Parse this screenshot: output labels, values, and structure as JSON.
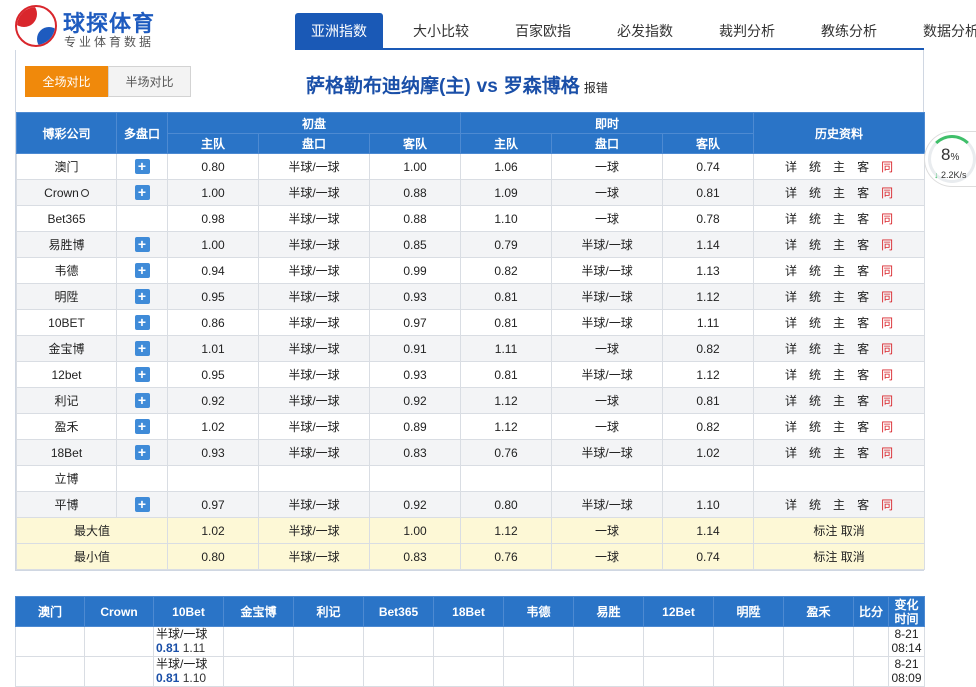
{
  "site": {
    "logo_name": "球探体育",
    "logo_sub": "专业体育数据"
  },
  "nav": [
    "亚洲指数",
    "大小比较",
    "百家欧指",
    "必发指数",
    "裁判分析",
    "教练分析",
    "数据分析"
  ],
  "tabs": [
    "全场对比",
    "半场对比"
  ],
  "match": {
    "home": "萨格勒布迪纳摩(主)",
    "vs": "vs",
    "away": "罗森博格",
    "report": "报错"
  },
  "table": {
    "headers": {
      "company": "博彩公司",
      "multi": "多盘口",
      "initial": "初盘",
      "live": "即时",
      "history": "历史资料",
      "home": "主队",
      "handicap": "盘口",
      "away": "客队"
    },
    "rows": [
      {
        "company": "澳门",
        "plus": true,
        "i_home": "0.80",
        "i_hc": "半球/一球",
        "i_away": "1.00",
        "l_home": "1.06",
        "l_hc": "一球",
        "l_away": "0.74",
        "hist": true
      },
      {
        "company": "Crown",
        "plus": true,
        "i_home": "1.00",
        "i_hc": "半球/一球",
        "i_away": "0.88",
        "l_home": "1.09",
        "l_hc": "一球",
        "l_away": "0.81",
        "hist": true
      },
      {
        "company": "Bet365",
        "plus": false,
        "i_home": "0.98",
        "i_hc": "半球/一球",
        "i_away": "0.88",
        "l_home": "1.10",
        "l_hc": "一球",
        "l_away": "0.78",
        "hist": true
      },
      {
        "company": "易胜博",
        "plus": true,
        "i_home": "1.00",
        "i_hc": "半球/一球",
        "i_away": "0.85",
        "l_home": "0.79",
        "l_hc": "半球/一球",
        "l_away": "1.14",
        "hist": true
      },
      {
        "company": "韦德",
        "plus": true,
        "i_home": "0.94",
        "i_hc": "半球/一球",
        "i_away": "0.99",
        "l_home": "0.82",
        "l_hc": "半球/一球",
        "l_away": "1.13",
        "hist": true
      },
      {
        "company": "明陞",
        "plus": true,
        "i_home": "0.95",
        "i_hc": "半球/一球",
        "i_away": "0.93",
        "l_home": "0.81",
        "l_hc": "半球/一球",
        "l_away": "1.12",
        "hist": true
      },
      {
        "company": "10BET",
        "plus": true,
        "i_home": "0.86",
        "i_hc": "半球/一球",
        "i_away": "0.97",
        "l_home": "0.81",
        "l_hc": "半球/一球",
        "l_away": "1.11",
        "hist": true
      },
      {
        "company": "金宝博",
        "plus": true,
        "i_home": "1.01",
        "i_hc": "半球/一球",
        "i_away": "0.91",
        "l_home": "1.11",
        "l_hc": "一球",
        "l_away": "0.82",
        "hist": true
      },
      {
        "company": "12bet",
        "plus": true,
        "i_home": "0.95",
        "i_hc": "半球/一球",
        "i_away": "0.93",
        "l_home": "0.81",
        "l_hc": "半球/一球",
        "l_away": "1.12",
        "hist": true
      },
      {
        "company": "利记",
        "plus": true,
        "i_home": "0.92",
        "i_hc": "半球/一球",
        "i_away": "0.92",
        "l_home": "1.12",
        "l_hc": "一球",
        "l_away": "0.81",
        "hist": true
      },
      {
        "company": "盈禾",
        "plus": true,
        "i_home": "1.02",
        "i_hc": "半球/一球",
        "i_away": "0.89",
        "l_home": "1.12",
        "l_hc": "一球",
        "l_away": "0.82",
        "hist": true
      },
      {
        "company": "18Bet",
        "plus": true,
        "i_home": "0.93",
        "i_hc": "半球/一球",
        "i_away": "0.83",
        "l_home": "0.76",
        "l_hc": "半球/一球",
        "l_away": "1.02",
        "hist": true
      },
      {
        "company": "立博",
        "plus": false,
        "i_home": "",
        "i_hc": "",
        "i_away": "",
        "l_home": "",
        "l_hc": "",
        "l_away": "",
        "hist": false
      },
      {
        "company": "平博",
        "plus": true,
        "i_home": "0.97",
        "i_hc": "半球/一球",
        "i_away": "0.92",
        "l_home": "0.80",
        "l_hc": "半球/一球",
        "l_away": "1.10",
        "hist": true
      }
    ],
    "plus_symbol": "+",
    "hist_links": [
      "详",
      "统",
      "主",
      "客",
      "同"
    ],
    "summary": [
      {
        "label": "最大值",
        "i_home": "1.02",
        "i_hc": "半球/一球",
        "i_away": "1.00",
        "l_home": "1.12",
        "l_hc": "一球",
        "l_away": "1.14",
        "actions": [
          "标注",
          "取消"
        ]
      },
      {
        "label": "最小值",
        "i_home": "0.80",
        "i_hc": "半球/一球",
        "i_away": "0.83",
        "l_home": "0.76",
        "l_hc": "一球",
        "l_away": "0.74",
        "actions": [
          "标注",
          "取消"
        ]
      }
    ]
  },
  "speed": {
    "percent": "8",
    "unit": "%",
    "rate": "2.2K/s"
  },
  "bottom": {
    "headers": [
      "澳门",
      "Crown",
      "10Bet",
      "金宝博",
      "利记",
      "Bet365",
      "18Bet",
      "韦德",
      "易胜",
      "12Bet",
      "明陞",
      "盈禾",
      "比分",
      "变化时间"
    ],
    "rows": [
      {
        "hc": "半球/一球",
        "v1": "0.81",
        "v2": "1.11",
        "date": "8-21",
        "time": "08:14"
      },
      {
        "hc": "半球/一球",
        "v1": "0.81",
        "v2": "1.10",
        "date": "8-21",
        "time": "08:09"
      }
    ]
  }
}
